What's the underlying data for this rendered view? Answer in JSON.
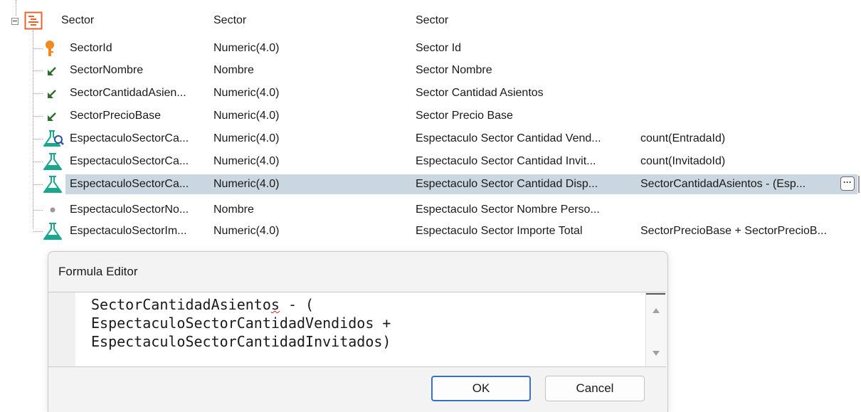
{
  "tree": {
    "root": {
      "name": "Sector",
      "type": "Sector",
      "description": "Sector",
      "icon": "transaction-icon"
    },
    "attributes": [
      {
        "name": "SectorId",
        "type": "Numeric(4.0)",
        "description": "Sector Id",
        "formula": "",
        "icon": "key-icon"
      },
      {
        "name": "SectorNombre",
        "type": "Nombre",
        "description": "Sector Nombre",
        "formula": "",
        "icon": "attribute-arrow-icon"
      },
      {
        "name": "SectorCantidadAsien...",
        "type": "Numeric(4.0)",
        "description": "Sector Cantidad Asientos",
        "formula": "",
        "icon": "attribute-arrow-icon"
      },
      {
        "name": "SectorPrecioBase",
        "type": "Numeric(4.0)",
        "description": "Sector Precio Base",
        "formula": "",
        "icon": "attribute-arrow-icon"
      },
      {
        "name": "EspectaculoSectorCa...",
        "type": "Numeric(4.0)",
        "description": "Espectaculo Sector Cantidad Vend...",
        "formula": "count(EntradaId)",
        "icon": "aggregate-formula-icon"
      },
      {
        "name": "EspectaculoSectorCa...",
        "type": "Numeric(4.0)",
        "description": "Espectaculo Sector Cantidad Invit...",
        "formula": "count(InvitadoId)",
        "icon": "formula-flask-icon"
      },
      {
        "name": "EspectaculoSectorCa...",
        "type": "Numeric(4.0)",
        "description": "Espectaculo Sector Cantidad Disp...",
        "formula": "SectorCantidadAsientos - (Esp...",
        "icon": "formula-flask-icon",
        "selected": true
      },
      {
        "name": "EspectaculoSectorNo...",
        "type": "Nombre",
        "description": "Espectaculo Sector Nombre Perso...",
        "formula": "",
        "icon": "dot-icon"
      },
      {
        "name": "EspectaculoSectorIm...",
        "type": "Numeric(4.0)",
        "description": "Espectaculo Sector Importe Total",
        "formula": "SectorPrecioBase + SectorPrecioB...",
        "icon": "formula-flask-icon"
      }
    ],
    "ellipsis_label": "···"
  },
  "dialog": {
    "title": "Formula Editor",
    "code_line1_a": "SectorCantidadAsiento",
    "code_line1_b": "s",
    "code_line1_c": " - (",
    "code_line2": "EspectaculoSectorCantidadVendidos +",
    "code_line3": "EspectaculoSectorCantidadInvitados)",
    "ok_label": "OK",
    "cancel_label": "Cancel"
  },
  "colors": {
    "selection": "#cad6e0",
    "key": "#f08a1c",
    "arrow": "#2b6e2b",
    "flask": "#1aa78e",
    "ok_border": "#3a6fc4",
    "root_icon": "#e8632b"
  }
}
